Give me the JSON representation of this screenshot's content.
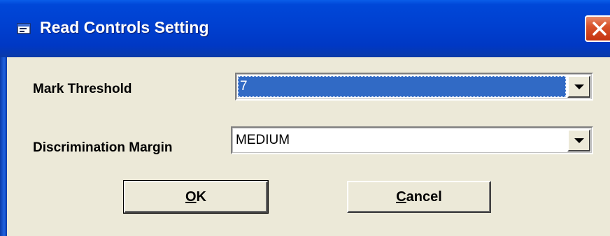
{
  "window": {
    "title": "Read Controls Setting",
    "close_icon": "close-x-icon",
    "app_icon": "window-app-icon"
  },
  "form": {
    "mark_threshold": {
      "label": "Mark Threshold",
      "value": "7"
    },
    "discrimination_margin": {
      "label": "Discrimination Margin",
      "value": "MEDIUM"
    }
  },
  "buttons": {
    "ok": {
      "mnemonic": "O",
      "rest": "K"
    },
    "cancel": {
      "mnemonic": "C",
      "rest": "ancel"
    }
  },
  "colors": {
    "titlebar": "#0040d0",
    "dialog_bg": "#ece9d8",
    "selection": "#316ac5",
    "close": "#d8522a"
  }
}
